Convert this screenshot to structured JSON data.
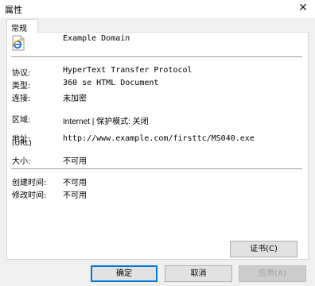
{
  "window": {
    "title": "属性",
    "close_glyph": "✕"
  },
  "tabs": [
    {
      "label": "常规"
    }
  ],
  "item": {
    "name": "Example Domain",
    "icon": "ie-document-icon"
  },
  "properties": {
    "protocol": {
      "label": "协议:",
      "value": "HyperText Transfer Protocol"
    },
    "type": {
      "label": "类型:",
      "value": "360 se HTML Document"
    },
    "connection": {
      "label": "连接:",
      "value": "未加密"
    },
    "zone": {
      "label": "区域:",
      "value": "Internet | 保护模式: 关闭"
    },
    "address": {
      "label": "地址:",
      "sublabel": "(URL)",
      "value": "http://www.example.com/firsttc/MS040.exe"
    },
    "size": {
      "label": "大小:",
      "value": "不可用"
    },
    "created": {
      "label": "创建时间:",
      "value": "不可用"
    },
    "modified": {
      "label": "修改时间:",
      "value": "不可用"
    }
  },
  "buttons": {
    "certificate": "证书(C)",
    "ok": "确定",
    "cancel": "取消",
    "apply": "应用(A)"
  },
  "colors": {
    "ie_blue": "#1f73c8",
    "ie_gold": "#f3b626",
    "accent": "#0078d7"
  }
}
